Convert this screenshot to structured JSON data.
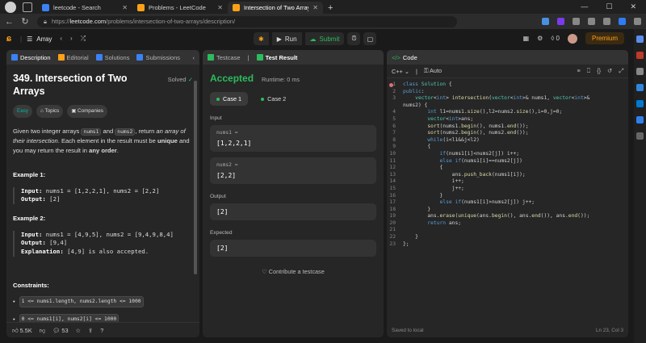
{
  "browser": {
    "tabs": [
      {
        "title": "leetcode - Search",
        "favicon_color": "#3b82f6",
        "active": false
      },
      {
        "title": "Problems - LeetCode",
        "favicon_color": "#ffa116",
        "active": false
      },
      {
        "title": "Intersection of Two Arrays - LeetCode",
        "favicon_color": "#ffa116",
        "active": true
      }
    ],
    "new_tab": "+",
    "url_scheme": "https://",
    "url_host": "leetcode.com",
    "url_path": "/problems/intersection-of-two-arrays/description/"
  },
  "header": {
    "list_name": "Array",
    "run_label": "Run",
    "submit_label": "Submit",
    "streak_count": "0",
    "premium_label": "Premium"
  },
  "description_panel": {
    "tabs": [
      "Description",
      "Editorial",
      "Solutions",
      "Submissions"
    ],
    "title": "349. Intersection of Two Arrays",
    "solved_label": "Solved",
    "chips": [
      "Easy",
      "Topics",
      "Companies"
    ],
    "statement": {
      "p1": "Given two integer arrays ",
      "code1": "nums1",
      "p2": " and ",
      "code2": "nums2",
      "p3": ", return ",
      "em1": "an array of their intersection",
      "p4": ". Each element in the result must be ",
      "b1": "unique",
      "p5": " and you may return the result in ",
      "b2": "any order",
      "p6": "."
    },
    "examples": [
      {
        "title": "Example 1:",
        "input": "nums1 = [1,2,2,1], nums2 = [2,2]",
        "output": "[2]",
        "explanation": ""
      },
      {
        "title": "Example 2:",
        "input": "nums1 = [4,9,5], nums2 = [9,4,9,8,4]",
        "output": "[9,4]",
        "explanation": "[4,9] is also accepted."
      }
    ],
    "labels": {
      "input": "Input:",
      "output": "Output:",
      "explanation": "Explanation:"
    },
    "constraints_title": "Constraints:",
    "constraints": [
      "1 <= nums1.length, nums2.length <= 1000",
      "0 <= nums1[i], nums2[i] <= 1000"
    ],
    "footer": {
      "likes": "5.5K",
      "comments": "53"
    }
  },
  "test_panel": {
    "tabs": [
      "Testcase",
      "Test Result"
    ],
    "status": "Accepted",
    "runtime": "Runtime: 0 ms",
    "cases": [
      "Case 1",
      "Case 2"
    ],
    "input_label": "Input",
    "inputs": [
      {
        "name": "nums1 =",
        "value": "[1,2,2,1]"
      },
      {
        "name": "nums2 =",
        "value": "[2,2]"
      }
    ],
    "output_label": "Output",
    "output": "[2]",
    "expected_label": "Expected",
    "expected": "[2]",
    "contribute": "Contribute a testcase"
  },
  "code_panel": {
    "title": "Code",
    "language": "C++",
    "auto_label": "Auto",
    "lines": [
      "class Solution {",
      "public:",
      "    vector<int> intersection(vector<int>& nums1, vector<int>&",
      "nums2) {",
      "        int l1=nums1.size(),l2=nums2.size(),i=0,j=0;",
      "        vector<int>ans;",
      "        sort(nums1.begin(), nums1.end());",
      "        sort(nums2.begin(), nums2.end());",
      "        while(i<l1&&j<l2)",
      "        {",
      "            if(nums1[i]<nums2[j]) i++;",
      "            else if(nums1[i]==nums2[j])",
      "            {",
      "                ans.push_back(nums1[i]);",
      "                i++;",
      "                j++;",
      "            }",
      "            else if(nums1[i]>nums2[j]) j++;",
      "        }",
      "        ans.erase(unique(ans.begin(), ans.end()), ans.end());",
      "        return ans;",
      "",
      "    }",
      "};"
    ],
    "line_numbers": [
      "1",
      "2",
      "3",
      "",
      "4",
      "5",
      "6",
      "7",
      "8",
      "9",
      "10",
      "11",
      "12",
      "13",
      "14",
      "15",
      "16",
      "17",
      "18",
      "19",
      "20",
      "21",
      "22",
      "23"
    ],
    "saved_label": "Saved to local",
    "cursor_pos": "Ln 23, Col 3"
  }
}
